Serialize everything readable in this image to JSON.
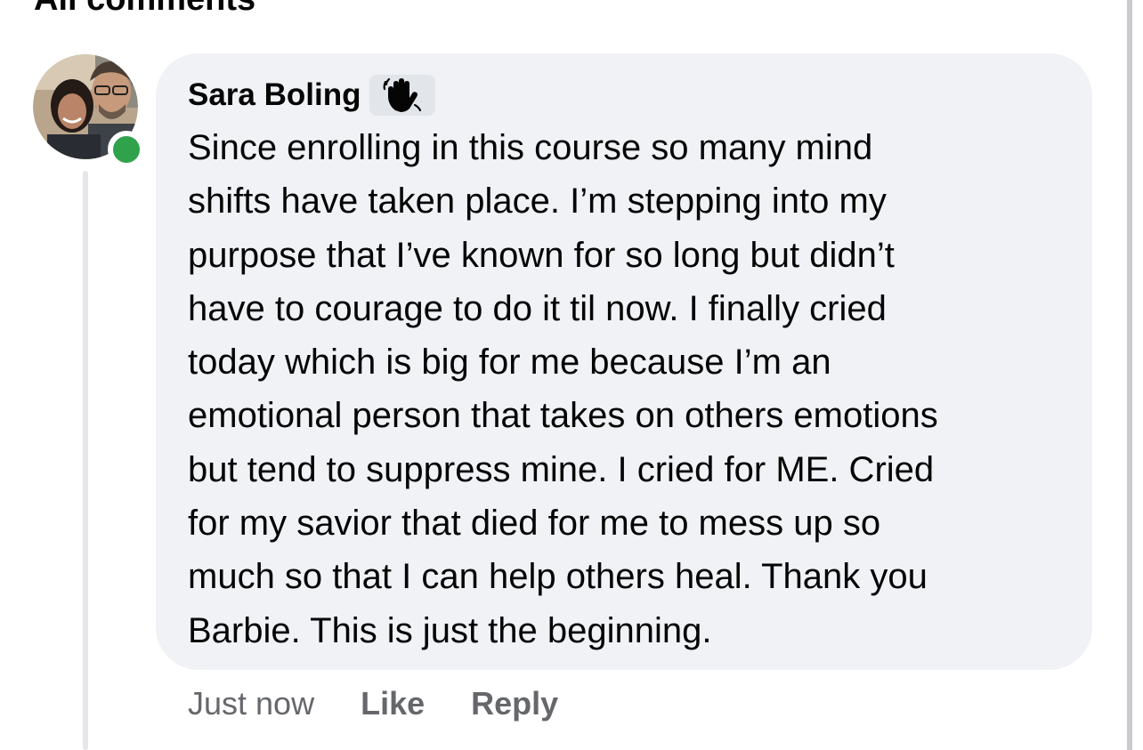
{
  "section": {
    "title": "All comments"
  },
  "comment": {
    "author": "Sara Boling",
    "author_online": true,
    "badge_icon": "waving-hand-icon",
    "text": "Since enrolling in this course so many mind\nshifts have taken place. I’m stepping into my\npurpose that I’ve known for so long but didn’t\nhave to courage to do it til now. I finally cried\ntoday which is big for me because I’m an\nemotional person that takes on others emotions\nbut tend to suppress mine.  I cried for ME. Cried\nfor my savior that died for me to mess up so\nmuch so that I can help others heal. Thank you\nBarbie. This is just the beginning.",
    "timestamp": "Just now",
    "like_label": "Like",
    "reply_label": "Reply"
  },
  "colors": {
    "bubble_background": "#f0f2f5",
    "online_indicator": "#31a24c",
    "secondary_text": "#65676b"
  }
}
